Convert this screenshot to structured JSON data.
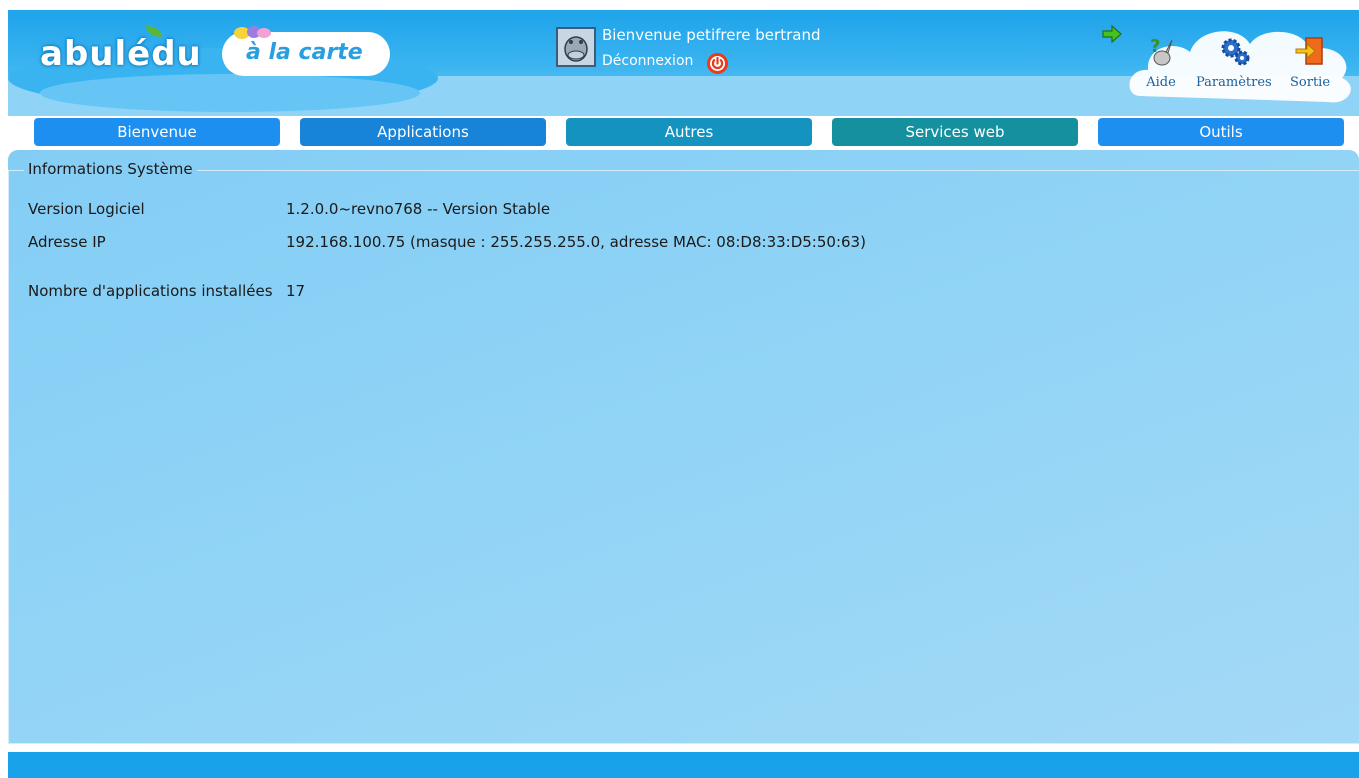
{
  "header": {
    "logo_text": "abulédu",
    "subtitle": "à la carte",
    "welcome": "Bienvenue petifrere bertrand",
    "logout": "Déconnexion"
  },
  "toolbar": {
    "help_label": "Aide",
    "settings_label": "Paramètres",
    "exit_label": "Sortie"
  },
  "nav": {
    "tabs": [
      {
        "label": "Bienvenue",
        "color": "#1d8ff0"
      },
      {
        "label": "Applications",
        "color": "#1784da"
      },
      {
        "label": "Autres",
        "color": "#1492c0"
      },
      {
        "label": "Services web",
        "color": "#15909f"
      },
      {
        "label": "Outils",
        "color": "#1d8ff0"
      }
    ]
  },
  "system_info": {
    "legend": "Informations Système",
    "rows": [
      {
        "label": "Version Logiciel",
        "value": "1.2.0.0~revno768 -- Version Stable"
      },
      {
        "label": "Adresse IP",
        "value": "192.168.100.75 (masque : 255.255.255.0, adresse MAC: 08:D8:33:D5:50:63)"
      },
      {
        "label": "Nombre d'applications installées",
        "value": "17"
      }
    ]
  },
  "colors": {
    "header_blue": "#1fa3ea",
    "panel_blue": "#8fd3f6",
    "footer_blue": "#17a2e9",
    "logout_red": "#ea3a1c"
  }
}
